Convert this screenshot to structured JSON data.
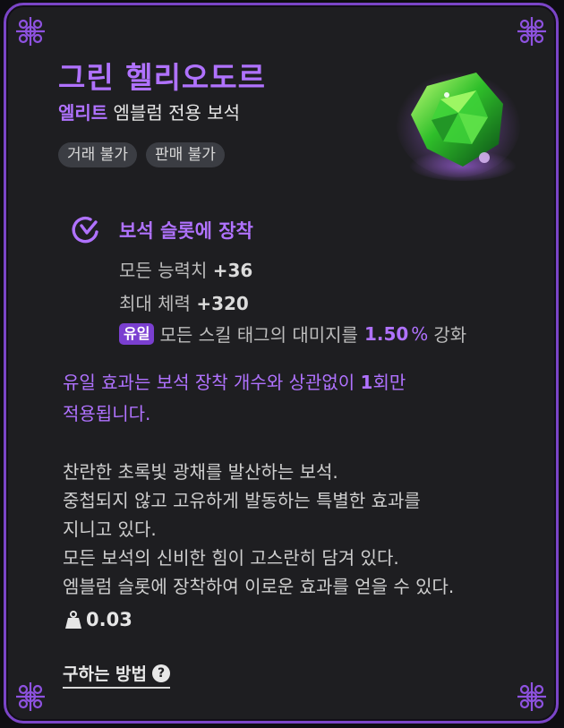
{
  "item": {
    "name": "그린 헬리오도르",
    "grade": "엘리트",
    "subtitle_rest": " 엠블럼 전용 보석",
    "tags": [
      "거래 불가",
      "판매 불가"
    ],
    "gem_icon": "green-gem-icon"
  },
  "equip": {
    "title": "보석 슬롯에 장착",
    "stats": [
      {
        "label": "모든 능력치 ",
        "value": "+36"
      },
      {
        "label": "최대 체력 ",
        "value": "+320"
      }
    ],
    "unique": {
      "badge": "유일",
      "text_before": "모든 스킬 태그의 대미지를",
      "percent": "1.50",
      "unit": "%",
      "text_after": "강화"
    }
  },
  "note": {
    "part1": "유일 효과는 보석 장착 개수와 상관없이 ",
    "count": "1",
    "part2": "회만",
    "line2": "적용됩니다."
  },
  "description": [
    "찬란한 초록빛 광채를 발산하는 보석.",
    "중첩되지 않고 고유하게 발동하는 특별한 효과를",
    "지니고 있다.",
    "모든 보석의 신비한 힘이 고스란히 담겨 있다.",
    "엠블럼 슬롯에 장착하여 이로운 효과를 얻을 수 있다."
  ],
  "weight": {
    "icon": "weight-icon",
    "value": "0.03"
  },
  "howto": {
    "label": "구하는 방법",
    "icon": "help-icon",
    "glyph": "?"
  },
  "colors": {
    "accent": "#b072ff",
    "border": "#7b45c8",
    "background": "#1e1e21"
  }
}
